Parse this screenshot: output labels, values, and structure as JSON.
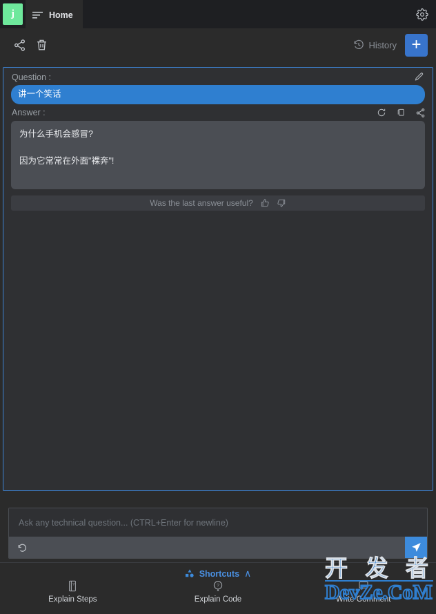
{
  "titlebar": {
    "logo_text": "j",
    "tab_label": "Home",
    "menu_icon": "menu-lines-icon",
    "settings_icon": "gear-icon"
  },
  "toolbar": {
    "share_icon": "share-nodes-icon",
    "delete_icon": "trash-icon",
    "history_label": "History",
    "history_icon": "clock-rewind-icon",
    "new_chat_label": "+"
  },
  "conversation": {
    "question_label": "Question :",
    "edit_icon": "pencil-icon",
    "question_text": "讲一个笑话",
    "answer_label": "Answer :",
    "answer_icons": [
      "refresh-icon",
      "copy-icon",
      "share-nodes-icon"
    ],
    "answer_paragraphs": [
      "为什么手机会感冒?",
      "因为它常常在外面\"裸奔\"!"
    ],
    "feedback_text": "Was the last answer useful?",
    "thumbs_up_icon": "thumbs-up-icon",
    "thumbs_down_icon": "thumbs-down-icon"
  },
  "input": {
    "placeholder": "Ask any technical question... (CTRL+Enter for newline)",
    "value": "",
    "undo_icon": "undo-arrow-icon",
    "send_icon": "send-plane-icon"
  },
  "shortcuts": {
    "title": "Shortcuts",
    "shapes_icon": "shapes-icon",
    "chevron": "∧",
    "items": [
      {
        "label": "Explain Steps",
        "icon": "book-steps-icon"
      },
      {
        "label": "Explain Code",
        "icon": "question-bubble-icon"
      },
      {
        "label": "Write Comment",
        "icon": "comment-icon"
      }
    ]
  },
  "watermark": {
    "top": "开 发 者",
    "bottom": "DevZe.CoM"
  },
  "colors": {
    "accent_blue": "#3874cb",
    "question_blue": "#2f7fd0",
    "logo_green": "#6ee89c",
    "panel_border": "#3d85d6",
    "bg_dark": "#2b2b2b",
    "titlebar_dark": "#1e1f22",
    "answer_bg": "#4b4e54"
  }
}
